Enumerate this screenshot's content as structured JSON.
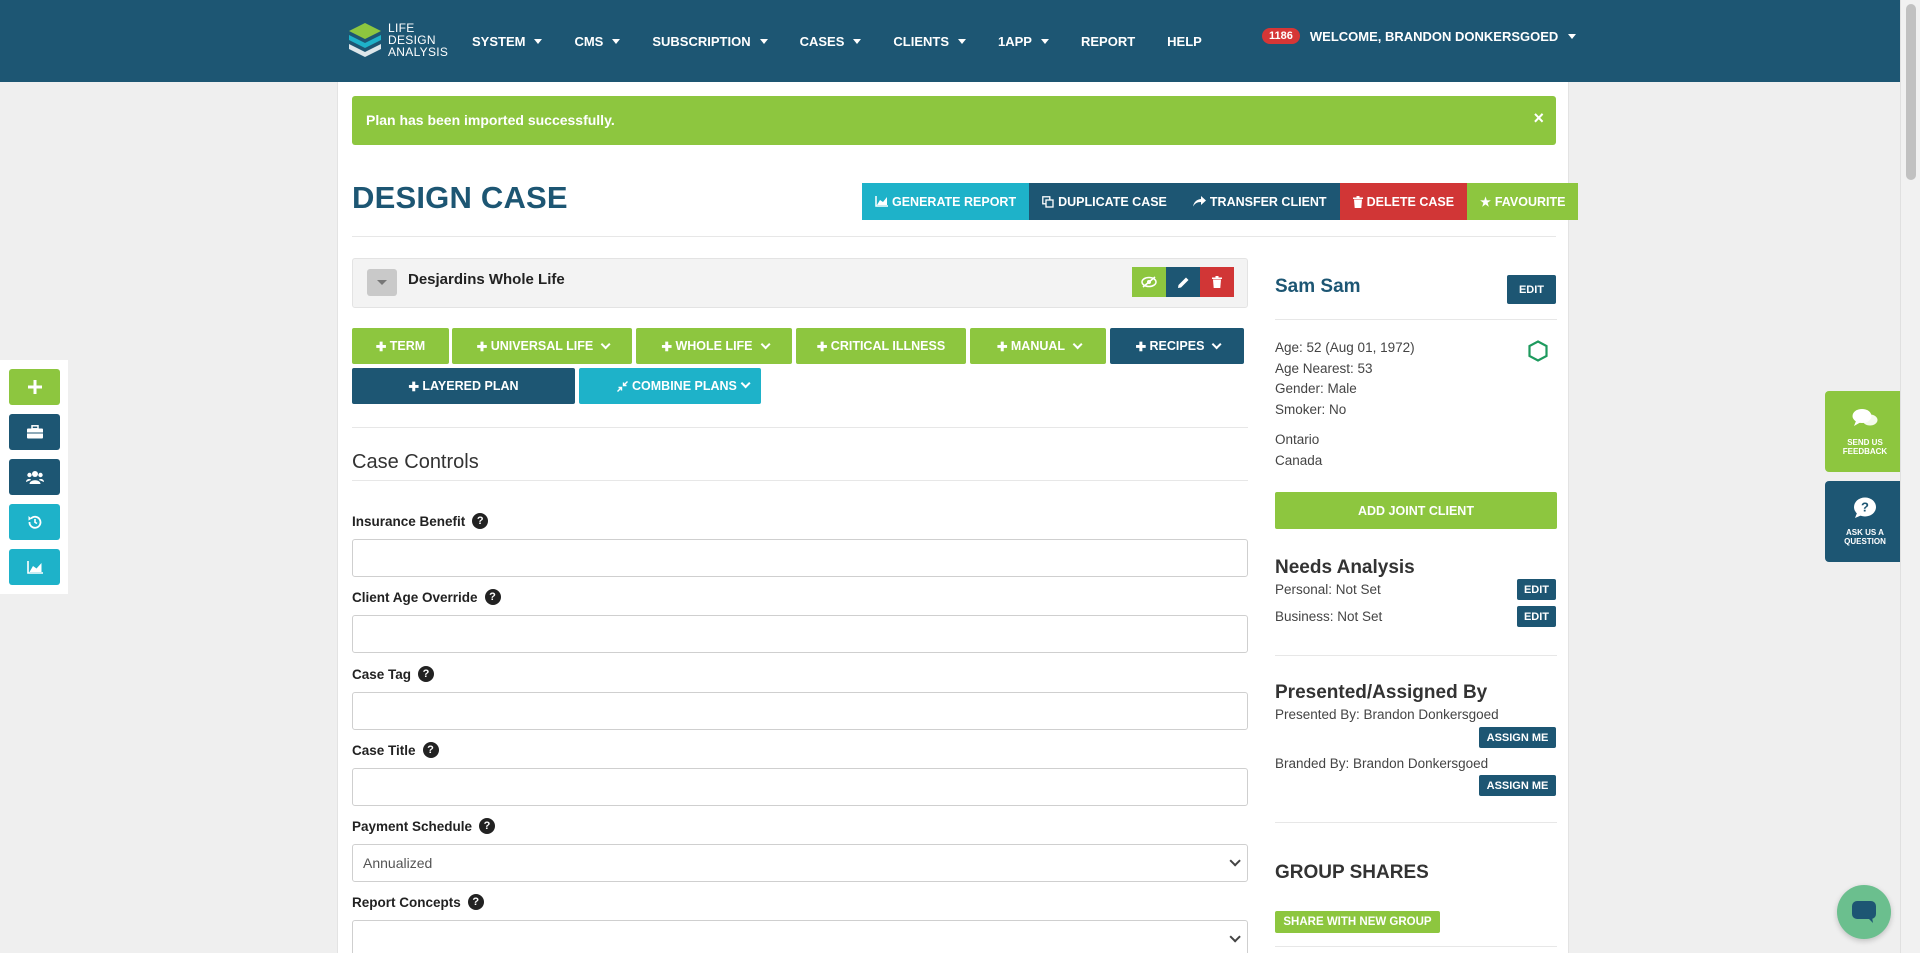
{
  "logo": {
    "line1": "LIFE",
    "line2": "DESIGN",
    "line3": "ANALYSIS"
  },
  "nav": {
    "items": [
      {
        "label": "SYSTEM",
        "dropdown": true
      },
      {
        "label": "CMS",
        "dropdown": true
      },
      {
        "label": "SUBSCRIPTION",
        "dropdown": true
      },
      {
        "label": "CASES",
        "dropdown": true
      },
      {
        "label": "CLIENTS",
        "dropdown": true
      },
      {
        "label": "1APP",
        "dropdown": true
      },
      {
        "label": "REPORT",
        "dropdown": false
      },
      {
        "label": "HELP",
        "dropdown": false
      }
    ],
    "notification_count": "1186",
    "welcome": "WELCOME, BRANDON DONKERSGOED"
  },
  "alert": {
    "message": "Plan has been imported successfully.",
    "close": "×"
  },
  "page": {
    "title": "DESIGN CASE"
  },
  "actions": {
    "generate_report": "GENERATE REPORT",
    "duplicate_case": "DUPLICATE CASE",
    "transfer_client": "TRANSFER CLIENT",
    "delete_case": "DELETE CASE",
    "favourite": "FAVOURITE"
  },
  "plan": {
    "name": "Desjardins Whole Life"
  },
  "add_buttons": {
    "term": "TERM",
    "universal_life": "UNIVERSAL LIFE",
    "whole_life": "WHOLE LIFE",
    "critical_illness": "CRITICAL ILLNESS",
    "manual": "MANUAL",
    "recipes": "RECIPES",
    "layered_plan": "LAYERED PLAN",
    "combine_plans": "COMBINE PLANS"
  },
  "case_controls": {
    "title": "Case Controls",
    "fields": {
      "insurance_benefit": {
        "label": "Insurance Benefit",
        "value": ""
      },
      "client_age_override": {
        "label": "Client Age Override",
        "value": ""
      },
      "case_tag": {
        "label": "Case Tag",
        "value": ""
      },
      "case_title": {
        "label": "Case Title",
        "value": ""
      },
      "payment_schedule": {
        "label": "Payment Schedule",
        "value": "Annualized"
      },
      "report_concepts": {
        "label": "Report Concepts",
        "value": ""
      }
    }
  },
  "client": {
    "name": "Sam Sam",
    "edit": "EDIT",
    "age": "Age: 52 (Aug 01, 1972)",
    "age_nearest": "Age Nearest: 53",
    "gender": "Gender: Male",
    "smoker": "Smoker: No",
    "province": "Ontario",
    "country": "Canada",
    "add_joint": "ADD JOINT CLIENT"
  },
  "needs_analysis": {
    "title": "Needs Analysis",
    "personal": "Personal: Not Set",
    "business": "Business: Not Set",
    "edit": "EDIT"
  },
  "presented": {
    "title": "Presented/Assigned By",
    "presented_by": "Presented By: Brandon Donkersgoed",
    "branded_by": "Branded By: Brandon Donkersgoed",
    "assign_me": "ASSIGN ME"
  },
  "group_shares": {
    "title": "GROUP SHARES",
    "share_button": "SHARE WITH NEW GROUP"
  },
  "floating": {
    "feedback_line1": "SEND US",
    "feedback_line2": "FEEDBACK",
    "ask_line1": "ASK US A",
    "ask_line2": "QUESTION"
  },
  "colors": {
    "navy": "#1d5673",
    "green": "#8dc63f",
    "teal": "#1eb2c9",
    "red": "#d13636"
  }
}
